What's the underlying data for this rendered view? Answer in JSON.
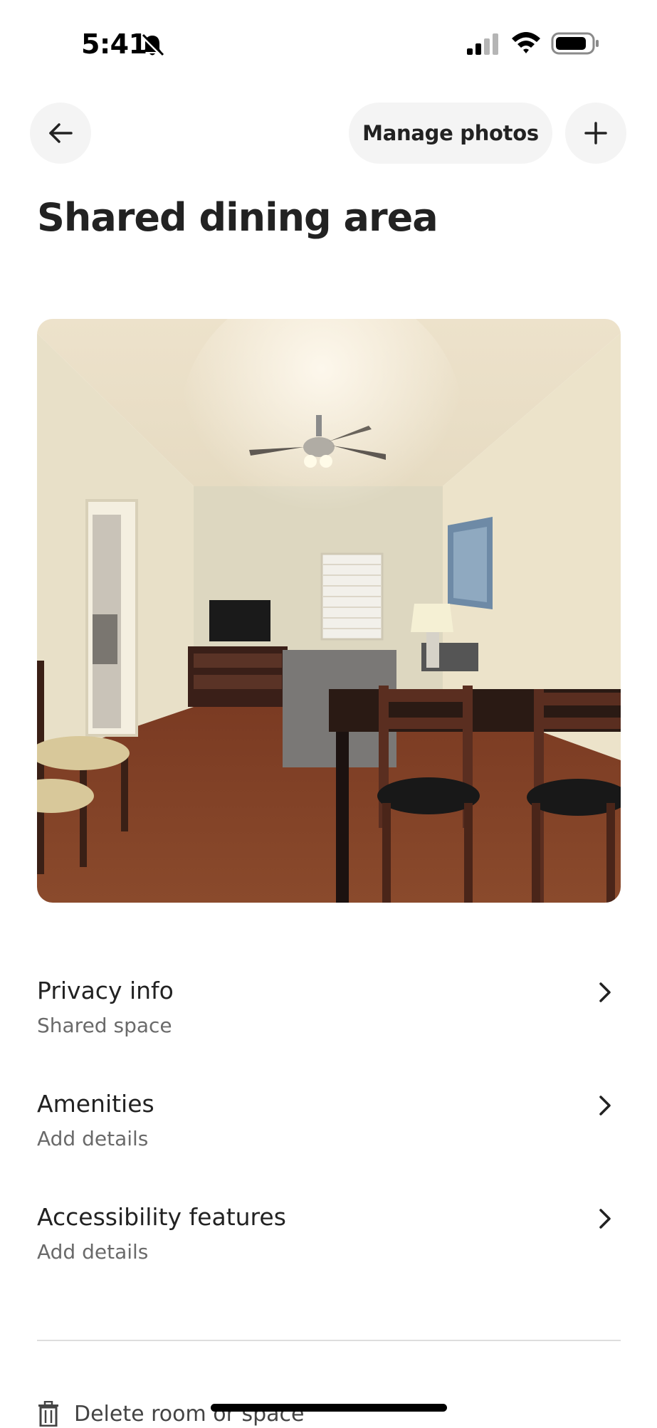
{
  "status_bar": {
    "time": "5:41",
    "icons": [
      "bell-slash-icon",
      "signal-icon",
      "wifi-icon",
      "battery-icon"
    ]
  },
  "header": {
    "back_icon": "arrow-left-icon",
    "manage_photos_label": "Manage photos",
    "add_icon": "plus-icon"
  },
  "page": {
    "title": "Shared dining area"
  },
  "photo": {
    "description_icon": "room-photo"
  },
  "settings": [
    {
      "title": "Privacy info",
      "subtitle": "Shared space"
    },
    {
      "title": "Amenities",
      "subtitle": "Add details"
    },
    {
      "title": "Accessibility features",
      "subtitle": "Add details"
    }
  ],
  "footer": {
    "delete_label": "Delete room or space",
    "delete_icon": "trash-icon"
  },
  "colors": {
    "text_primary": "#222222",
    "text_secondary": "#6a6a6a",
    "button_bg": "#f4f4f4",
    "divider": "#dddddd"
  }
}
